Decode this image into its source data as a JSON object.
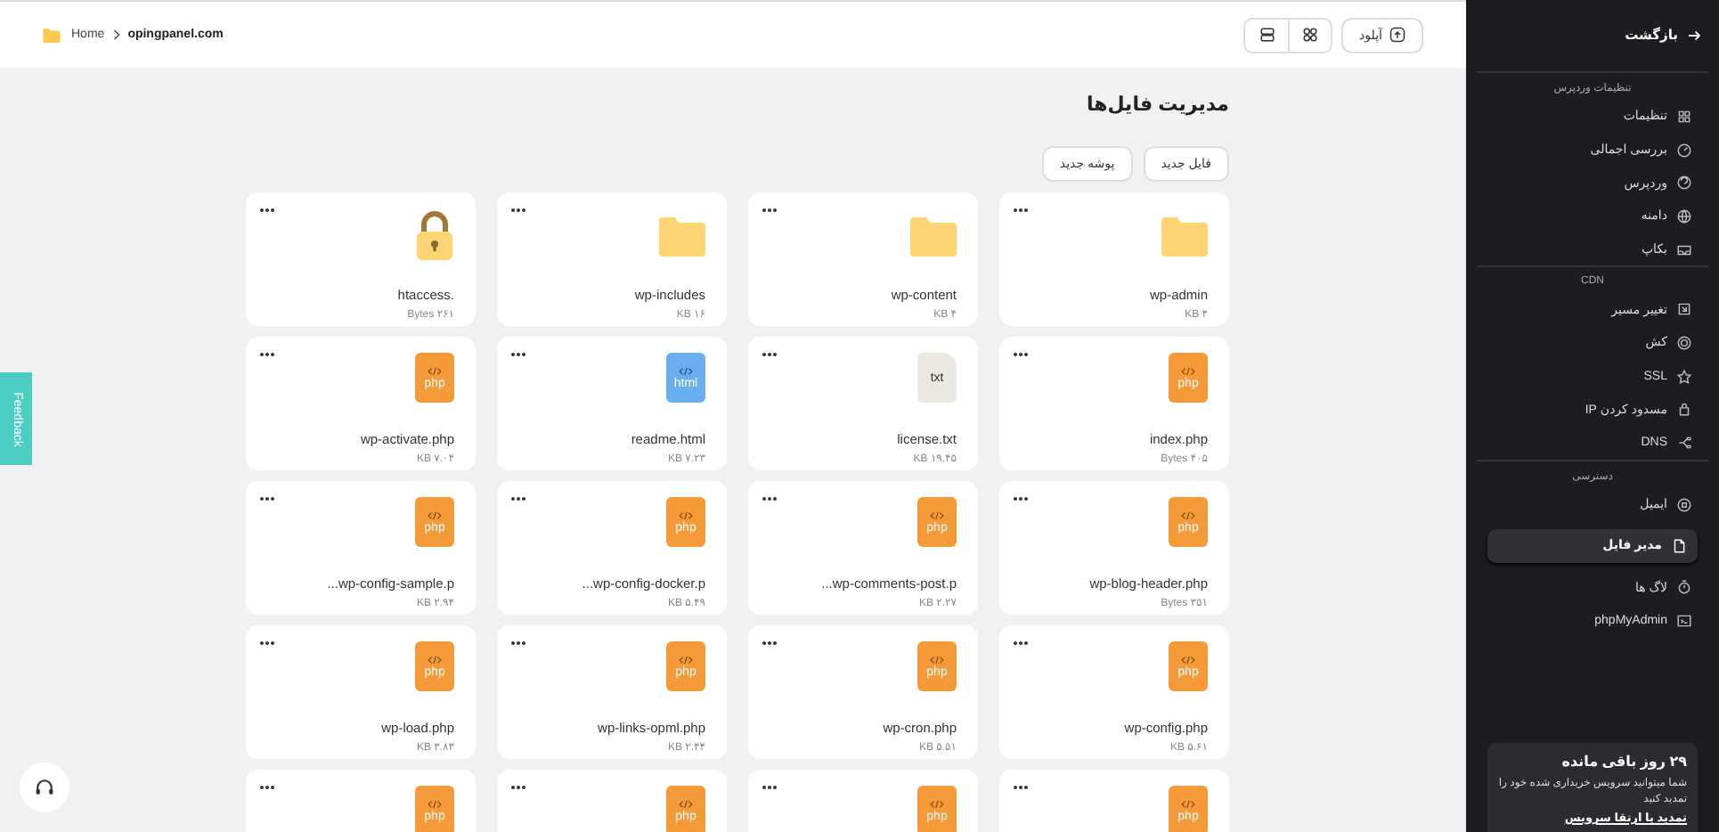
{
  "header": {
    "home_link": "Home",
    "current_folder": "opingpanel.com",
    "upload_button": "آپلود",
    "view_toggles": [
      {
        "kind": "list"
      },
      {
        "kind": "grid"
      }
    ]
  },
  "page": {
    "title": "مدیریت فایل‌ها",
    "actions": [
      "فایل جدید",
      "پوشه جدید"
    ]
  },
  "files": [
    {
      "kind": "folder",
      "name": "wp-admin",
      "size": "۴ KB"
    },
    {
      "kind": "folder",
      "name": "wp-content",
      "size": "۴ KB"
    },
    {
      "kind": "folder",
      "name": "wp-includes",
      "size": "۱۶ KB"
    },
    {
      "kind": "lock",
      "name": ".htaccess",
      "size": "۲۶۱ Bytes"
    },
    {
      "kind": "code",
      "icon_label": "php",
      "name": "index.php",
      "size": "۴۰۵ Bytes"
    },
    {
      "kind": "text",
      "icon_label": "txt",
      "name": "license.txt",
      "size": "۱۹.۴۵ KB"
    },
    {
      "kind": "markup",
      "icon_label": "html",
      "name": "readme.html",
      "size": "۷.۲۳ KB"
    },
    {
      "kind": "code",
      "icon_label": "php",
      "name": "wp-activate.php",
      "size": "۷.۰۴ KB"
    },
    {
      "kind": "code",
      "icon_label": "php",
      "name": "wp-blog-header.php",
      "size": "۳۵۱ Bytes"
    },
    {
      "kind": "code",
      "icon_label": "php",
      "name": "wp-comments-post.p...",
      "size": "۲.۲۷ KB"
    },
    {
      "kind": "code",
      "icon_label": "php",
      "name": "wp-config-docker.p...",
      "size": "۵.۴۹ KB"
    },
    {
      "kind": "code",
      "icon_label": "php",
      "name": "wp-config-sample.p...",
      "size": "۲.۹۴ KB"
    },
    {
      "kind": "code",
      "icon_label": "php",
      "name": "wp-config.php",
      "size": "۵.۶۱ KB"
    },
    {
      "kind": "code",
      "icon_label": "php",
      "name": "wp-cron.php",
      "size": "۵.۵۱ KB"
    },
    {
      "kind": "code",
      "icon_label": "php",
      "name": "wp-links-opml.php",
      "size": "۲.۴۴ KB"
    },
    {
      "kind": "code",
      "icon_label": "php",
      "name": "wp-load.php",
      "size": "۳.۸۳ KB"
    },
    {
      "kind": "code",
      "icon_label": "php"
    },
    {
      "kind": "code",
      "icon_label": "php"
    },
    {
      "kind": "code",
      "icon_label": "php"
    },
    {
      "kind": "code",
      "icon_label": "php"
    }
  ],
  "feedback_tab": "Feedback",
  "sidebar": {
    "back": "بازگشت",
    "sections": [
      {
        "title": "تنظیمات وردپرس",
        "items": [
          {
            "label": "تنظیمات",
            "selected": false
          },
          {
            "label": "بررسی اجمالی",
            "selected": false
          },
          {
            "label": "وردپرس",
            "selected": false
          },
          {
            "label": "دامنه",
            "selected": false
          },
          {
            "label": "بکاپ",
            "selected": false
          }
        ]
      },
      {
        "title": "CDN",
        "items": [
          {
            "label": "تغییر مسیر",
            "selected": false
          },
          {
            "label": "کش",
            "selected": false
          },
          {
            "label": "SSL",
            "selected": false
          },
          {
            "label": "مسدود کردن IP",
            "selected": false
          },
          {
            "label": "DNS",
            "selected": false
          }
        ]
      },
      {
        "title": "دسترسی",
        "items": [
          {
            "label": "ایمیل",
            "selected": false
          },
          {
            "label": "مدیر فایل",
            "selected": true
          },
          {
            "label": "لاگ ها",
            "selected": false
          },
          {
            "label": "phpMyAdmin",
            "selected": false
          }
        ]
      }
    ],
    "plan_card": {
      "title": "۲۹ روز باقی مانده",
      "text": "شما میتوانید سرویس خریداری شده خود را تمدید کنید",
      "link": "تمدید یا ارتقا سرویس"
    }
  }
}
